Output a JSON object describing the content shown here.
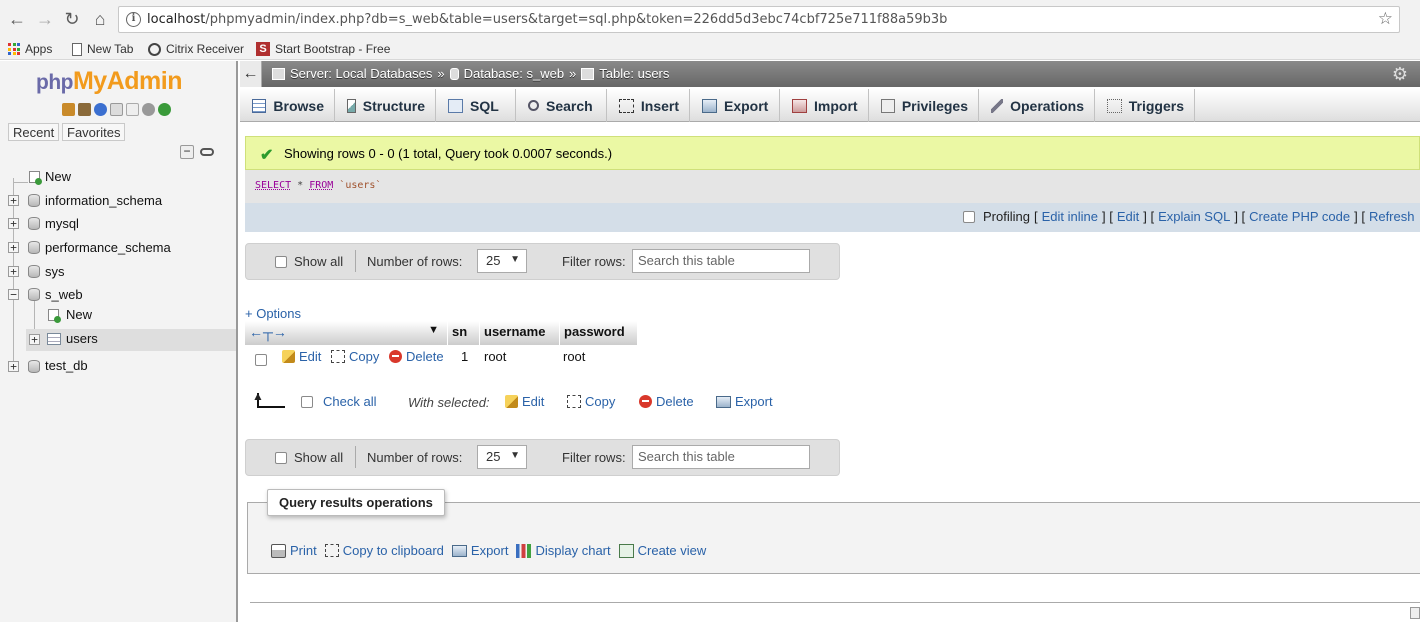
{
  "browser": {
    "url_host": "localhost",
    "url_path": "/phpmyadmin/index.php?db=s_web&table=users&target=sql.php&token=226dd5d3ebc74cbf725e711f88a59b3b",
    "bookmarks": [
      {
        "label": "Apps",
        "icon": "apps-grid-icon"
      },
      {
        "label": "New Tab",
        "icon": "page-icon"
      },
      {
        "label": "Citrix Receiver",
        "icon": "citrix-icon"
      },
      {
        "label": "Start Bootstrap - Free",
        "icon": "start-bootstrap-icon"
      }
    ]
  },
  "nav": {
    "logo": {
      "php": "php",
      "myadmin": "MyAdmin"
    },
    "tabs": {
      "recent": "Recent",
      "favorites": "Favorites"
    },
    "tree": {
      "new": "New",
      "databases": [
        "information_schema",
        "mysql",
        "performance_schema",
        "sys",
        "s_web",
        "test_db"
      ],
      "s_web_children": {
        "new": "New",
        "table": "users"
      }
    }
  },
  "topbar": {
    "server": "Server: Local Databases",
    "database": "Database: s_web",
    "table": "Table: users",
    "sep": "»"
  },
  "tabs": [
    {
      "label": "Browse",
      "icon": "browse-icon"
    },
    {
      "label": "Structure",
      "icon": "structure-icon"
    },
    {
      "label": "SQL",
      "icon": "sql-icon"
    },
    {
      "label": "Search",
      "icon": "search-icon"
    },
    {
      "label": "Insert",
      "icon": "insert-icon"
    },
    {
      "label": "Export",
      "icon": "export-icon"
    },
    {
      "label": "Import",
      "icon": "import-icon"
    },
    {
      "label": "Privileges",
      "icon": "privileges-icon"
    },
    {
      "label": "Operations",
      "icon": "operations-icon"
    },
    {
      "label": "Triggers",
      "icon": "triggers-icon"
    }
  ],
  "result": {
    "success_message": "Showing rows 0 - 0 (1 total, Query took 0.0007 seconds.)",
    "sql": {
      "kw1": "SELECT",
      "rest1": " * ",
      "kw2": "FROM",
      "table": " `users`"
    },
    "actions": {
      "profiling": "Profiling",
      "edit_inline": "Edit inline",
      "edit": "Edit",
      "explain": "Explain SQL",
      "php": "Create PHP code",
      "refresh": "Refresh"
    }
  },
  "navbar": {
    "show_all": "Show all",
    "rows_label": "Number of rows:",
    "rows_value": "25",
    "filter_label": "Filter rows:",
    "filter_placeholder": "Search this table"
  },
  "table": {
    "options_link": "+ Options",
    "columns": [
      "sn",
      "username",
      "password"
    ],
    "rows": [
      {
        "sn": "1",
        "username": "root",
        "password": "root"
      }
    ],
    "row_actions": {
      "edit": "Edit",
      "copy": "Copy",
      "delete": "Delete"
    }
  },
  "with_selected": {
    "check_all": "Check all",
    "label": "With selected:",
    "edit": "Edit",
    "copy": "Copy",
    "delete": "Delete",
    "export": "Export"
  },
  "query_ops": {
    "legend": "Query results operations",
    "print": "Print",
    "copy_clipboard": "Copy to clipboard",
    "export": "Export",
    "display_chart": "Display chart",
    "create_view": "Create view"
  },
  "colors": {
    "success_bg": "#ebf8a4",
    "link": "#2a62a8",
    "logo_orange": "#f29b1d",
    "logo_blue": "#6a6aa8"
  }
}
